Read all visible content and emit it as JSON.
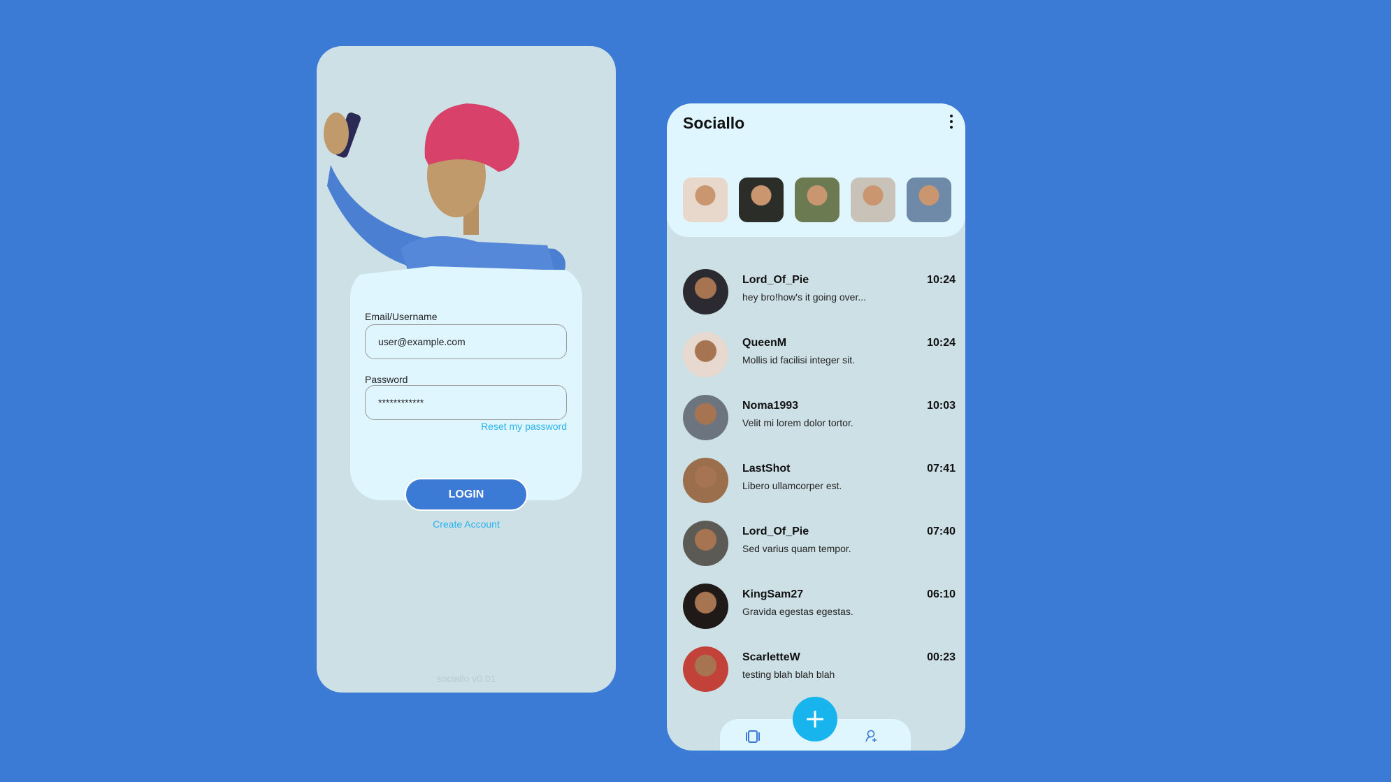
{
  "login": {
    "email_label": "Email/Username",
    "email_value": "user@example.com",
    "password_label": "Password",
    "password_value": "************",
    "reset_link": "Reset my password",
    "login_button": "LOGIN",
    "create_account": "Create Account",
    "version": "sociallo v0.01"
  },
  "feed": {
    "title": "Sociallo",
    "stories": [
      {
        "color": "#e8d8cc"
      },
      {
        "color": "#2a2d28"
      },
      {
        "color": "#6b7a50"
      },
      {
        "color": "#c9c2b8"
      },
      {
        "color": "#6e8aa8"
      }
    ],
    "chats": [
      {
        "name": "Lord_Of_Pie",
        "message": "hey bro!how's it going over...",
        "time": "10:24",
        "color": "#2b2a30"
      },
      {
        "name": "QueenM",
        "message": "Mollis id facilisi integer sit.",
        "time": "10:24",
        "color": "#e7d9cf"
      },
      {
        "name": "Noma1993",
        "message": "Velit mi lorem dolor tortor.",
        "time": "10:03",
        "color": "#6c7480"
      },
      {
        "name": "LastShot",
        "message": "Libero ullamcorper est.",
        "time": "07:41",
        "color": "#9b6e4c"
      },
      {
        "name": "Lord_Of_Pie",
        "message": "Sed varius quam tempor.",
        "time": "07:40",
        "color": "#5c5a55"
      },
      {
        "name": "KingSam27",
        "message": "Gravida egestas egestas.",
        "time": "06:10",
        "color": "#1f1a17"
      },
      {
        "name": "ScarletteW",
        "message": "testing blah blah blah",
        "time": "00:23",
        "color": "#c2423a"
      }
    ]
  }
}
